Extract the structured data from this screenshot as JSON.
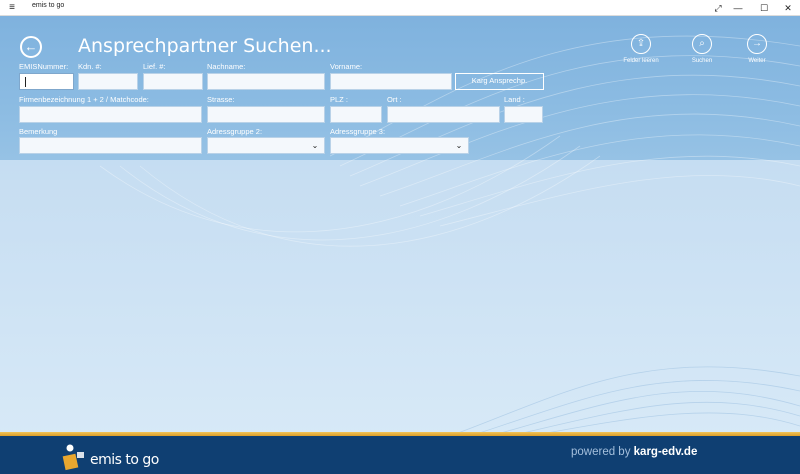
{
  "window": {
    "app_title": "emis to go",
    "controls": {
      "menu_glyph": "≡",
      "restore_glyph": "⤢",
      "minimize_glyph": "—",
      "maximize_glyph": "☐",
      "close_glyph": "✕"
    }
  },
  "header": {
    "back_glyph": "←",
    "title": "Ansprechpartner Suchen..."
  },
  "appbar": [
    {
      "label": "Felder leeren",
      "icon": "clear-fields-icon",
      "glyph": "⇪"
    },
    {
      "label": "Suchen",
      "icon": "search-icon",
      "glyph": "⌕"
    },
    {
      "label": "Weiter",
      "icon": "arrow-right-icon",
      "glyph": "→"
    }
  ],
  "form": {
    "labels": {
      "emis_nummer": "EMISNummer:",
      "kdn": "Kdn. #:",
      "lief": "Lief. #:",
      "nachname": "Nachname:",
      "vorname": "Vorname:",
      "firmenbezeichnung": "Firmenbezeichnung 1 + 2 / Matchcode:",
      "strasse": "Strasse:",
      "plz": "PLZ :",
      "ort": "Ort :",
      "land": "Land :",
      "bemerkung": "Bemerkung",
      "adressgruppe2": "Adressgruppe 2:",
      "adressgruppe3": "Adressgruppe 3:"
    },
    "values": {
      "emis_nummer": "",
      "kdn": "",
      "lief": "",
      "nachname": "",
      "vorname": "",
      "firmenbezeichnung": "",
      "strasse": "",
      "plz": "",
      "ort": "",
      "land": "",
      "bemerkung": "",
      "adressgruppe2": "",
      "adressgruppe3": ""
    },
    "karg_button": "Karg Ansprechp.",
    "chevron_glyph": "⌄"
  },
  "footer": {
    "brand": "emis to go",
    "powered_by": "powered by ",
    "company": "karg-edv.de"
  },
  "colors": {
    "header_band": "#85b7e0",
    "footer_bg": "#0f3f72",
    "footer_stripe": "#e6aa33",
    "text_on_blue": "#ffffff"
  }
}
